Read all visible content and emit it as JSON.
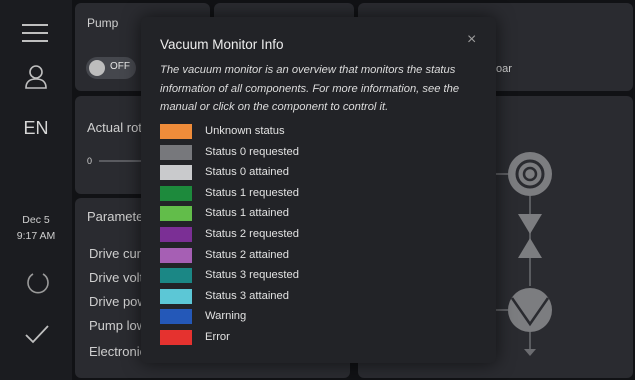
{
  "sidebar": {
    "language": "EN",
    "date": "Dec 5",
    "time": "9:17 AM"
  },
  "pump_card": {
    "title": "Pump",
    "toggle_label": "OFF"
  },
  "rotation_card": {
    "title": "Actual rot",
    "slider_min": "0"
  },
  "parameters_card": {
    "title": "Paramete",
    "rows": [
      "Drive curr",
      "Drive volt",
      "Drive pow",
      "Pump low",
      "Electronic"
    ]
  },
  "background": {
    "partial_text": "oar"
  },
  "modal": {
    "title": "Vacuum Monitor Info",
    "description": "The vacuum monitor is an overview that monitors the status information of all components. For more information, see the manual or click on the component to control it.",
    "close_glyph": "×",
    "legend": [
      {
        "label": "Unknown status",
        "color": "#ef8c3a"
      },
      {
        "label": "Status 0 requested",
        "color": "#77787c"
      },
      {
        "label": "Status 0 attained",
        "color": "#c9cacc"
      },
      {
        "label": "Status 1 requested",
        "color": "#1d8a3c"
      },
      {
        "label": "Status 1 attained",
        "color": "#62bd4a"
      },
      {
        "label": "Status 2 requested",
        "color": "#7b2f95"
      },
      {
        "label": "Status 2 attained",
        "color": "#a65fb4"
      },
      {
        "label": "Status 3 requested",
        "color": "#1b8785"
      },
      {
        "label": "Status 3 attained",
        "color": "#5cc7d6"
      },
      {
        "label": "Warning",
        "color": "#2458b8"
      },
      {
        "label": "Error",
        "color": "#e5322f"
      }
    ]
  },
  "icons": {
    "menu": "menu-icon",
    "user": "user-icon",
    "power": "power-icon",
    "confirm": "check-icon",
    "close": "close-icon"
  }
}
